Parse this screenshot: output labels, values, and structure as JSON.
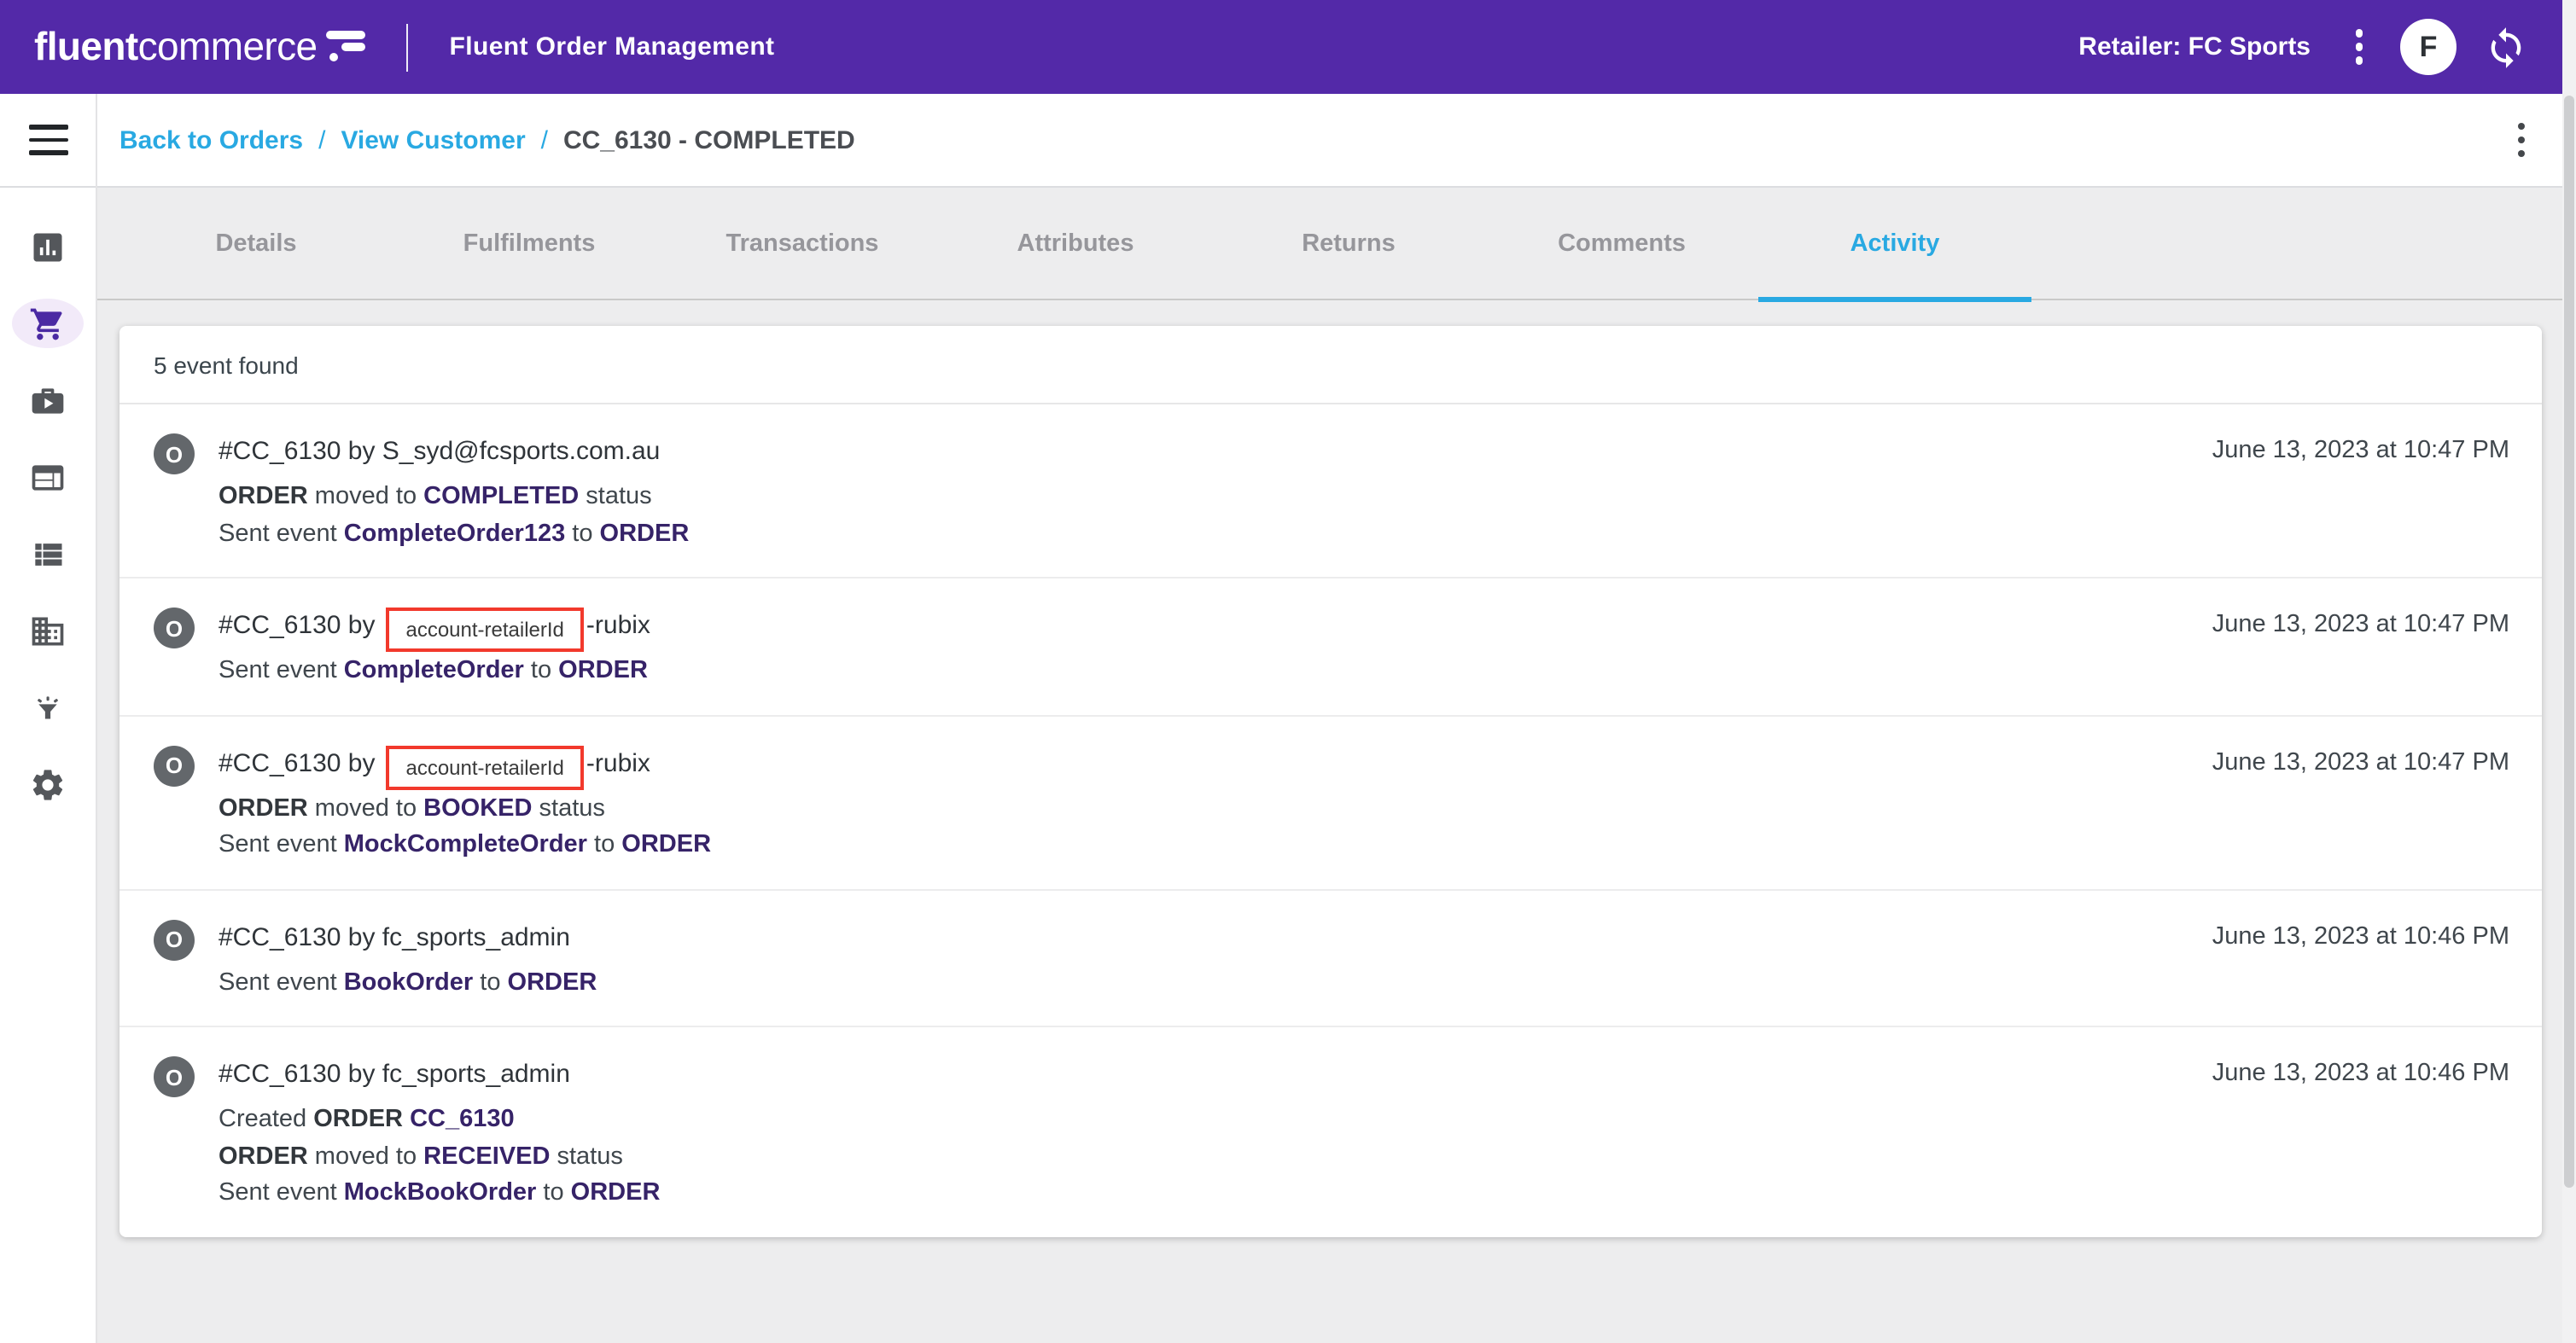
{
  "colors": {
    "brand_purple": "#5329a8",
    "active_icon_purple": "#4b2aa3",
    "link_blue": "#29a9e2",
    "event_purple": "#362368",
    "chip_red": "#f2392c"
  },
  "header": {
    "brand_bold": "fluent",
    "brand_light": "commerce",
    "app_title": "Fluent Order Management",
    "retailer_label": "Retailer: FC Sports",
    "avatar_letter": "F"
  },
  "sidebar": {
    "items": [
      {
        "icon": "bar-chart",
        "active": false
      },
      {
        "icon": "shopping-cart",
        "active": true
      },
      {
        "icon": "briefcase-play",
        "active": false
      },
      {
        "icon": "web-panel",
        "active": false
      },
      {
        "icon": "view-list",
        "active": false
      },
      {
        "icon": "building",
        "active": false
      },
      {
        "icon": "funnel-rays",
        "active": false
      },
      {
        "icon": "settings-gear",
        "active": false
      }
    ]
  },
  "breadcrumb": {
    "separator": "/",
    "items": [
      {
        "label": "Back to Orders",
        "type": "link"
      },
      {
        "label": "View Customer",
        "type": "link"
      },
      {
        "label": "CC_6130 - COMPLETED",
        "type": "current"
      }
    ]
  },
  "tabs": {
    "active": "Activity",
    "items": [
      "Details",
      "Fulfilments",
      "Transactions",
      "Attributes",
      "Returns",
      "Comments",
      "Activity"
    ]
  },
  "activity": {
    "count_text": "5 event found",
    "badge_letter": "O",
    "events": [
      {
        "title": [
          {
            "t": "#CC_6130 by S_syd@fcsports.com.au"
          }
        ],
        "lines": [
          [
            {
              "t": "ORDER",
              "s": "bold"
            },
            {
              "t": " moved to "
            },
            {
              "t": "COMPLETED",
              "s": "purple"
            },
            {
              "t": " status"
            }
          ],
          [
            {
              "t": "Sent event "
            },
            {
              "t": "CompleteOrder123",
              "s": "purple"
            },
            {
              "t": " to "
            },
            {
              "t": "ORDER",
              "s": "purple"
            }
          ]
        ],
        "timestamp": "June 13, 2023 at 10:47 PM"
      },
      {
        "title": [
          {
            "t": "#CC_6130 by"
          },
          {
            "t": "account-retailerId",
            "s": "chip"
          },
          {
            "t": "-rubix"
          }
        ],
        "lines": [
          [
            {
              "t": "Sent event "
            },
            {
              "t": "CompleteOrder",
              "s": "purple"
            },
            {
              "t": " to "
            },
            {
              "t": "ORDER",
              "s": "purple"
            }
          ]
        ],
        "timestamp": "June 13, 2023 at 10:47 PM"
      },
      {
        "title": [
          {
            "t": "#CC_6130 by"
          },
          {
            "t": "account-retailerId",
            "s": "chip"
          },
          {
            "t": "-rubix"
          }
        ],
        "lines": [
          [
            {
              "t": "ORDER",
              "s": "bold"
            },
            {
              "t": " moved to "
            },
            {
              "t": "BOOKED",
              "s": "purple"
            },
            {
              "t": " status"
            }
          ],
          [
            {
              "t": "Sent event "
            },
            {
              "t": "MockCompleteOrder",
              "s": "purple"
            },
            {
              "t": " to "
            },
            {
              "t": "ORDER",
              "s": "purple"
            }
          ]
        ],
        "timestamp": "June 13, 2023 at 10:47 PM"
      },
      {
        "title": [
          {
            "t": "#CC_6130 by fc_sports_admin"
          }
        ],
        "lines": [
          [
            {
              "t": "Sent event "
            },
            {
              "t": "BookOrder",
              "s": "purple"
            },
            {
              "t": " to "
            },
            {
              "t": "ORDER",
              "s": "purple"
            }
          ]
        ],
        "timestamp": "June 13, 2023 at 10:46 PM"
      },
      {
        "title": [
          {
            "t": "#CC_6130 by fc_sports_admin"
          }
        ],
        "lines": [
          [
            {
              "t": "Created "
            },
            {
              "t": "ORDER ",
              "s": "bold"
            },
            {
              "t": "CC_6130",
              "s": "purple"
            }
          ],
          [
            {
              "t": "ORDER",
              "s": "bold"
            },
            {
              "t": " moved to "
            },
            {
              "t": "RECEIVED",
              "s": "purple"
            },
            {
              "t": " status"
            }
          ],
          [
            {
              "t": "Sent event "
            },
            {
              "t": "MockBookOrder",
              "s": "purple"
            },
            {
              "t": " to "
            },
            {
              "t": "ORDER",
              "s": "purple"
            }
          ]
        ],
        "timestamp": "June 13, 2023 at 10:46 PM"
      }
    ]
  }
}
